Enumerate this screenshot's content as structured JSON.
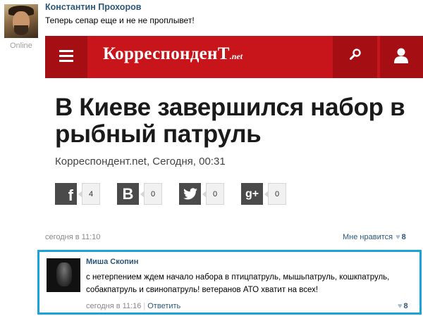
{
  "post": {
    "author": "Константин Прохоров",
    "status": "Online",
    "text": "Теперь сепар еще и не не проплывет!",
    "time": "сегодня в 11:10",
    "like_label": "Мне нравится",
    "like_count": "8"
  },
  "embed": {
    "logo_main": "КорреспонденТ",
    "logo_tld": ".net",
    "headline": "В Киеве завершился набор в рыбный патруль",
    "byline": "Корреспондент.net, Сегодня, 00:31",
    "shares": [
      {
        "network": "f",
        "count": "4"
      },
      {
        "network": "B",
        "count": "0"
      },
      {
        "network": "twitter-bird",
        "count": "0"
      },
      {
        "network": "g+",
        "count": "0"
      }
    ],
    "colors": {
      "brand_red": "#c8151b",
      "brand_dark_red": "#a50f14"
    }
  },
  "comment": {
    "author": "Миша Скопин",
    "text": "с нетерпением ждем начало набора в птицпатруль, мышьпатруль, кошкпатруль, собакпатруль и свинопатруль! ветеранов АТО хватит на всех!",
    "time": "сегодня в 11:16",
    "separator": "|",
    "reply_label": "Ответить",
    "like_count": "8",
    "colors": {
      "highlight_border": "#19a3d8"
    }
  }
}
